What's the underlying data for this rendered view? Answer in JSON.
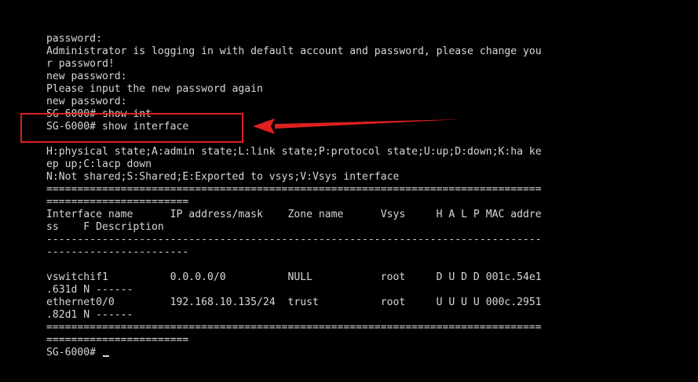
{
  "terminal": {
    "lines": [
      "password:",
      "Administrator is logging in with default account and password, please change you",
      "r password!",
      "new password:",
      "Please input the new password again",
      "new password:",
      "SG-6000# show int",
      "SG-6000# show interface",
      "",
      "H:physical state;A:admin state;L:link state;P:protocol state;U:up;D:down;K:ha ke",
      "ep up;C:lacp down",
      "N:Not shared;S:Shared;E:Exported to vsys;V:Vsys interface",
      "================================================================================",
      "=======================",
      "Interface name      IP address/mask    Zone name      Vsys     H A L P MAC addre",
      "ss    F Description",
      "--------------------------------------------------------------------------------",
      "-----------------------",
      "",
      "vswitchif1          0.0.0.0/0          NULL           root     D U D D 001c.54e1",
      ".631d N ------",
      "ethernet0/0         192.168.10.135/24  trust          root     U U U U 000c.2951",
      ".82d1 N ------",
      "================================================================================",
      "=======================",
      "SG-6000# "
    ]
  },
  "annotation": {
    "color": "#e02020"
  }
}
